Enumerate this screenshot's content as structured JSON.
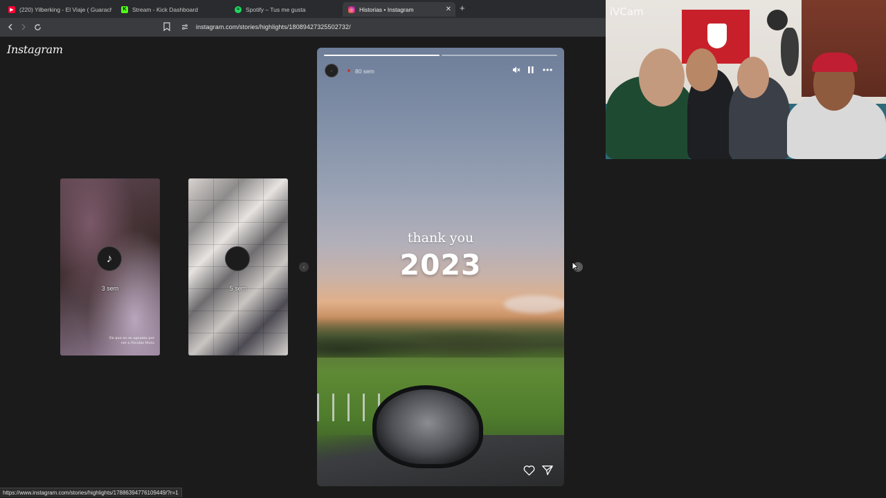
{
  "browser": {
    "tabs": [
      {
        "title": "(220) Yilberking - El Viaje ( Guaracha",
        "icon": "youtube-icon",
        "color": "#ff0033",
        "active": false
      },
      {
        "title": "Stream - Kick Dashboard",
        "icon": "kick-icon",
        "color": "#53fc18",
        "active": false
      },
      {
        "title": "Spotify – Tus me gusta",
        "icon": "spotify-icon",
        "color": "#1ed760",
        "active": false
      },
      {
        "title": "Historias • Instagram",
        "icon": "instagram-icon",
        "color": "#e1306c",
        "active": true
      }
    ],
    "close_glyph": "✕",
    "new_tab_glyph": "+",
    "url": "instagram.com/stories/highlights/18089427325502732/"
  },
  "page": {
    "logo": "Instagram",
    "previews": [
      {
        "time": "3 sem",
        "caption": ""
      },
      {
        "time": "5 sem",
        "caption": ""
      }
    ],
    "preview_1_caption": "En que no se aguanta por ver a Nicolás Mora",
    "story": {
      "time": "80 sem",
      "progress": {
        "segments": 2,
        "current": 1,
        "fraction": 0.5
      },
      "text_line1": "thank you",
      "text_line2": "2023"
    }
  },
  "statusbar": {
    "link": "https://www.instagram.com/stories/highlights/17886394776109449/?r=1"
  },
  "webcam": {
    "label": "iVCam"
  },
  "colors": {
    "page_bg": "#1b1b1b",
    "toolbar_bg": "#3a3b3e",
    "tabbar_bg": "#2a2b2e"
  }
}
